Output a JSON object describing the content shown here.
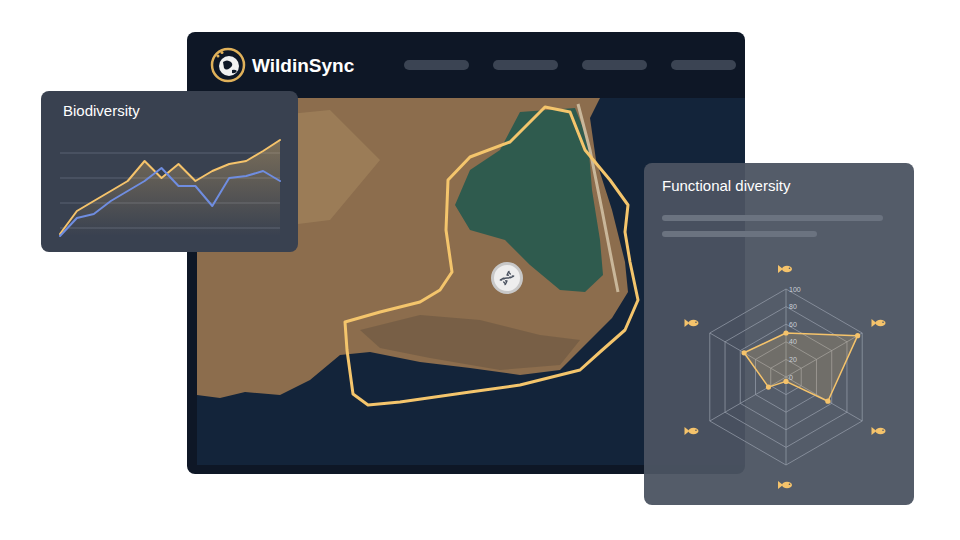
{
  "app": {
    "name": "WildinSync"
  },
  "biodiversity": {
    "title": "Biodiversity",
    "series": [
      {
        "color": "#f5c36b",
        "values": [
          2,
          25,
          35,
          45,
          55,
          75,
          58,
          72,
          55,
          65,
          72,
          75,
          85,
          96
        ]
      },
      {
        "color": "#6f8de0",
        "values": [
          0,
          18,
          22,
          35,
          45,
          55,
          68,
          50,
          50,
          30,
          58,
          60,
          65,
          55
        ]
      }
    ]
  },
  "functional_diversity": {
    "title": "Functional diversity",
    "ticks": [
      "100",
      "80",
      "60",
      "40",
      "20",
      "0"
    ],
    "values": [
      50,
      94,
      55,
      5,
      23,
      55
    ]
  }
}
